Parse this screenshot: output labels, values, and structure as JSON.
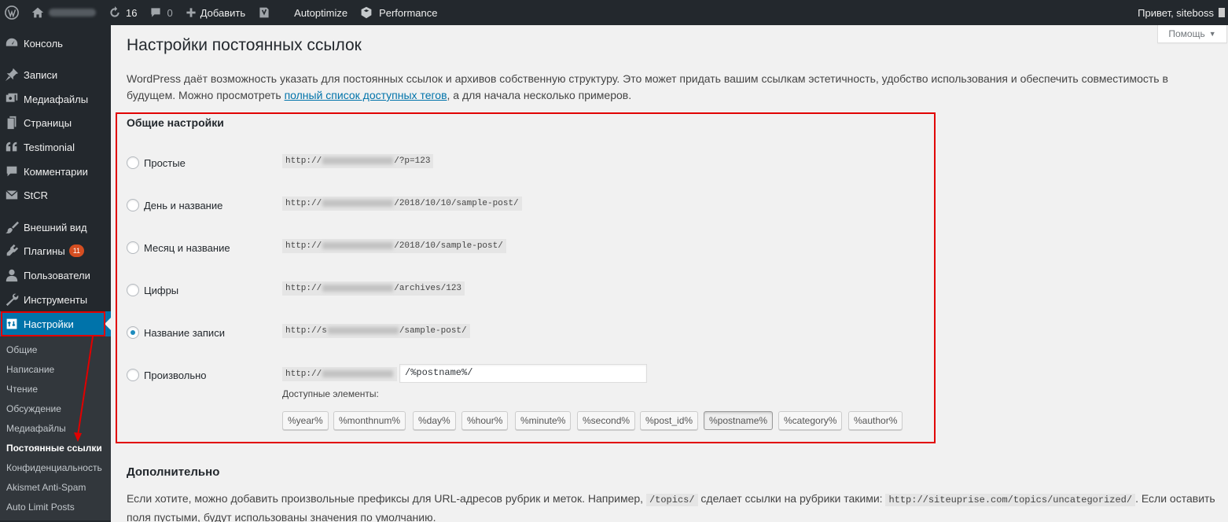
{
  "adminbar": {
    "comments_count": "0",
    "updates_count": "16",
    "add_label": "Добавить",
    "autoptimize": "Autoptimize",
    "performance": "Performance",
    "greeting": "Привет, siteboss"
  },
  "sidebar": {
    "items": [
      {
        "label": "Консоль",
        "icon": "dashboard-icon"
      },
      {
        "label": "Записи",
        "icon": "pin-icon"
      },
      {
        "label": "Медиафайлы",
        "icon": "media-icon"
      },
      {
        "label": "Страницы",
        "icon": "pages-icon"
      },
      {
        "label": "Testimonial",
        "icon": "quote-icon"
      },
      {
        "label": "Комментарии",
        "icon": "comment-icon"
      },
      {
        "label": "StCR",
        "icon": "mail-icon"
      },
      {
        "label": "Внешний вид",
        "icon": "brush-icon"
      },
      {
        "label": "Плагины",
        "icon": "plugin-icon",
        "badge": "11"
      },
      {
        "label": "Пользователи",
        "icon": "users-icon"
      },
      {
        "label": "Инструменты",
        "icon": "wrench-icon"
      },
      {
        "label": "Настройки",
        "icon": "settings-icon",
        "active": true
      }
    ],
    "submenu": [
      "Общие",
      "Написание",
      "Чтение",
      "Обсуждение",
      "Медиафайлы",
      "Постоянные ссылки",
      "Конфиденциальность",
      "Akismet Anti-Spam",
      "Auto Limit Posts"
    ]
  },
  "screen_options": "Помощь",
  "page": {
    "title": "Настройки постоянных ссылок",
    "intro_before": "WordPress даёт возможность указать для постоянных ссылок и архивов собственную структуру. Это может придать вашим ссылкам эстетичность, удобство использования и обеспечить совместимость в будущем. Можно просмотреть ",
    "intro_link": "полный список доступных тегов",
    "intro_after": ", а для начала несколько примеров."
  },
  "general": {
    "title": "Общие настройки",
    "options": [
      {
        "label": "Простые",
        "prefix": "http://",
        "suffix": "/?p=123",
        "checked": false
      },
      {
        "label": "День и название",
        "prefix": "http://",
        "suffix": "/2018/10/10/sample-post/",
        "checked": false
      },
      {
        "label": "Месяц и название",
        "prefix": "http://",
        "suffix": "/2018/10/sample-post/",
        "checked": false
      },
      {
        "label": "Цифры",
        "prefix": "http://",
        "suffix": "/archives/123",
        "checked": false
      },
      {
        "label": "Название записи",
        "prefix": "http://s",
        "suffix": "/sample-post/",
        "checked": true
      },
      {
        "label": "Произвольно",
        "prefix": "http://",
        "suffix": "",
        "checked": false
      }
    ],
    "custom_structure_value": "/%postname%/",
    "available_label": "Доступные элементы:",
    "tags": [
      "%year%",
      "%monthnum%",
      "%day%",
      "%hour%",
      "%minute%",
      "%second%",
      "%post_id%",
      "%postname%",
      "%category%",
      "%author%"
    ]
  },
  "extra": {
    "title": "Дополнительно",
    "text_1": "Если хотите, можно добавить произвольные префиксы для URL-адресов рубрик и меток. Например, ",
    "code_1": "/topics/",
    "text_2": " сделает ссылки на рубрики такими: ",
    "code_2": "http://siteuprise.com/topics/uncategorized/",
    "text_3": ". Если оставить поля пустыми, будут использованы значения по умолчанию."
  },
  "colors": {
    "highlight": "#e10000",
    "accent": "#0073aa",
    "sidebar": "#23282d"
  }
}
